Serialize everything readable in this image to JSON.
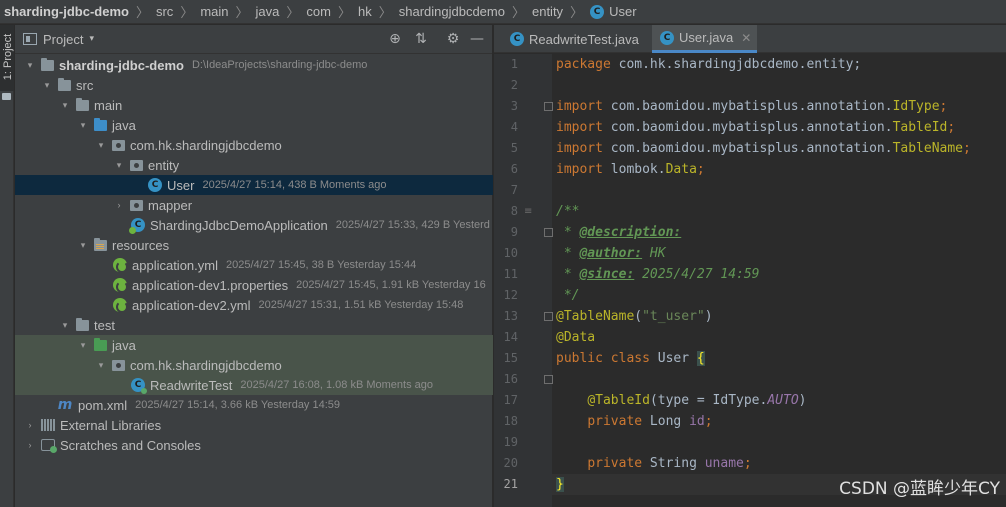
{
  "breadcrumb": {
    "items": [
      "sharding-jdbc-demo",
      "src",
      "main",
      "java",
      "com",
      "hk",
      "shardingjdbcdemo",
      "entity",
      "User"
    ],
    "class_badge": "C"
  },
  "left_stripe": {
    "project_label": "1: Project"
  },
  "project_panel": {
    "title": "Project",
    "dropdown": "▾",
    "buttons": {
      "locate": "⊕",
      "collapse": "⇅",
      "settings": "⚙",
      "hide": "—"
    },
    "tree": [
      {
        "arrow": "▾",
        "label": "sharding-jdbc-demo",
        "meta": "D:\\IdeaProjects\\sharding-jdbc-demo"
      },
      {
        "arrow": "▾",
        "label": "src",
        "meta": ""
      },
      {
        "arrow": "▾",
        "label": "main",
        "meta": ""
      },
      {
        "arrow": "▾",
        "label": "java",
        "meta": ""
      },
      {
        "arrow": "▾",
        "label": "com.hk.shardingjdbcdemo",
        "meta": ""
      },
      {
        "arrow": "▾",
        "label": "entity",
        "meta": ""
      },
      {
        "arrow": "",
        "label": "User",
        "meta": "2025/4/27 15:14, 438 B Moments ago"
      },
      {
        "arrow": "›",
        "label": "mapper",
        "meta": ""
      },
      {
        "arrow": "",
        "label": "ShardingJdbcDemoApplication",
        "meta": "2025/4/27 15:33, 429 B Yesterd"
      },
      {
        "arrow": "▾",
        "label": "resources",
        "meta": ""
      },
      {
        "arrow": "",
        "label": "application.yml",
        "meta": "2025/4/27 15:45, 38 B Yesterday 15:44"
      },
      {
        "arrow": "",
        "label": "application-dev1.properties",
        "meta": "2025/4/27 15:45, 1.91 kB Yesterday 16"
      },
      {
        "arrow": "",
        "label": "application-dev2.yml",
        "meta": "2025/4/27 15:31, 1.51 kB Yesterday 15:48"
      },
      {
        "arrow": "▾",
        "label": "test",
        "meta": ""
      },
      {
        "arrow": "▾",
        "label": "java",
        "meta": ""
      },
      {
        "arrow": "▾",
        "label": "com.hk.shardingjdbcdemo",
        "meta": ""
      },
      {
        "arrow": "",
        "label": "ReadwriteTest",
        "meta": "2025/4/27 16:08, 1.08 kB Moments ago"
      },
      {
        "arrow": "",
        "label": "pom.xml",
        "meta": "2025/4/27 15:14, 3.66 kB Yesterday 14:59"
      },
      {
        "arrow": "›",
        "label": "External Libraries",
        "meta": ""
      },
      {
        "arrow": "›",
        "label": "Scratches and Consoles",
        "meta": ""
      }
    ],
    "icons": {
      "class": "C",
      "maven": "m"
    }
  },
  "editor": {
    "tabs": [
      {
        "label": "ReadwriteTest.java",
        "close": "✕"
      },
      {
        "label": "User.java",
        "close": "✕"
      }
    ],
    "line_numbers": [
      "1",
      "2",
      "3",
      "4",
      "5",
      "6",
      "7",
      "8",
      "9",
      "10",
      "11",
      "12",
      "13",
      "14",
      "15",
      "16",
      "17",
      "18",
      "19",
      "20",
      "21"
    ],
    "gutter_mark": "≡",
    "code": {
      "l1": {
        "kw": "package",
        "rest": " com.hk.shardingjdbcdemo.entity;"
      },
      "l3": {
        "kw": "import",
        "a": " com.baomidou.mybatisplus.annotation.",
        "b": "IdType",
        "c": ";"
      },
      "l4": {
        "kw": "import",
        "a": " com.baomidou.mybatisplus.annotation.",
        "b": "TableId",
        "c": ";"
      },
      "l5": {
        "kw": "import",
        "a": " com.baomidou.mybatisplus.annotation.",
        "b": "TableName",
        "c": ";"
      },
      "l6": {
        "kw": "import",
        "a": " lombok.",
        "b": "Data",
        "c": ";"
      },
      "l8": {
        "text": "/**"
      },
      "l9": {
        "star": " * ",
        "tag": "@description:"
      },
      "l10": {
        "star": " * ",
        "tag": "@author:",
        "rest": " HK"
      },
      "l11": {
        "star": " * ",
        "tag": "@since:",
        "rest": " 2025/4/27 14:59"
      },
      "l12": {
        "text": " */"
      },
      "l13": {
        "ann": "@TableName",
        "p1": "(",
        "str": "\"t_user\"",
        "p2": ")"
      },
      "l14": {
        "ann": "@Data"
      },
      "l15": {
        "kw": "public class",
        "name": " User ",
        "brace": "{"
      },
      "l17": {
        "ann": "@TableId",
        "a": "(type = IdType.",
        "cnst": "AUTO",
        "b": ")"
      },
      "l18": {
        "kw": "private",
        "type": " Long ",
        "fld": "id",
        "end": ";"
      },
      "l20": {
        "kw": "private",
        "type": " String ",
        "fld": "uname",
        "end": ";"
      },
      "l21": {
        "brace": "}"
      }
    }
  },
  "watermark": "CSDN @蓝眸少年CY"
}
